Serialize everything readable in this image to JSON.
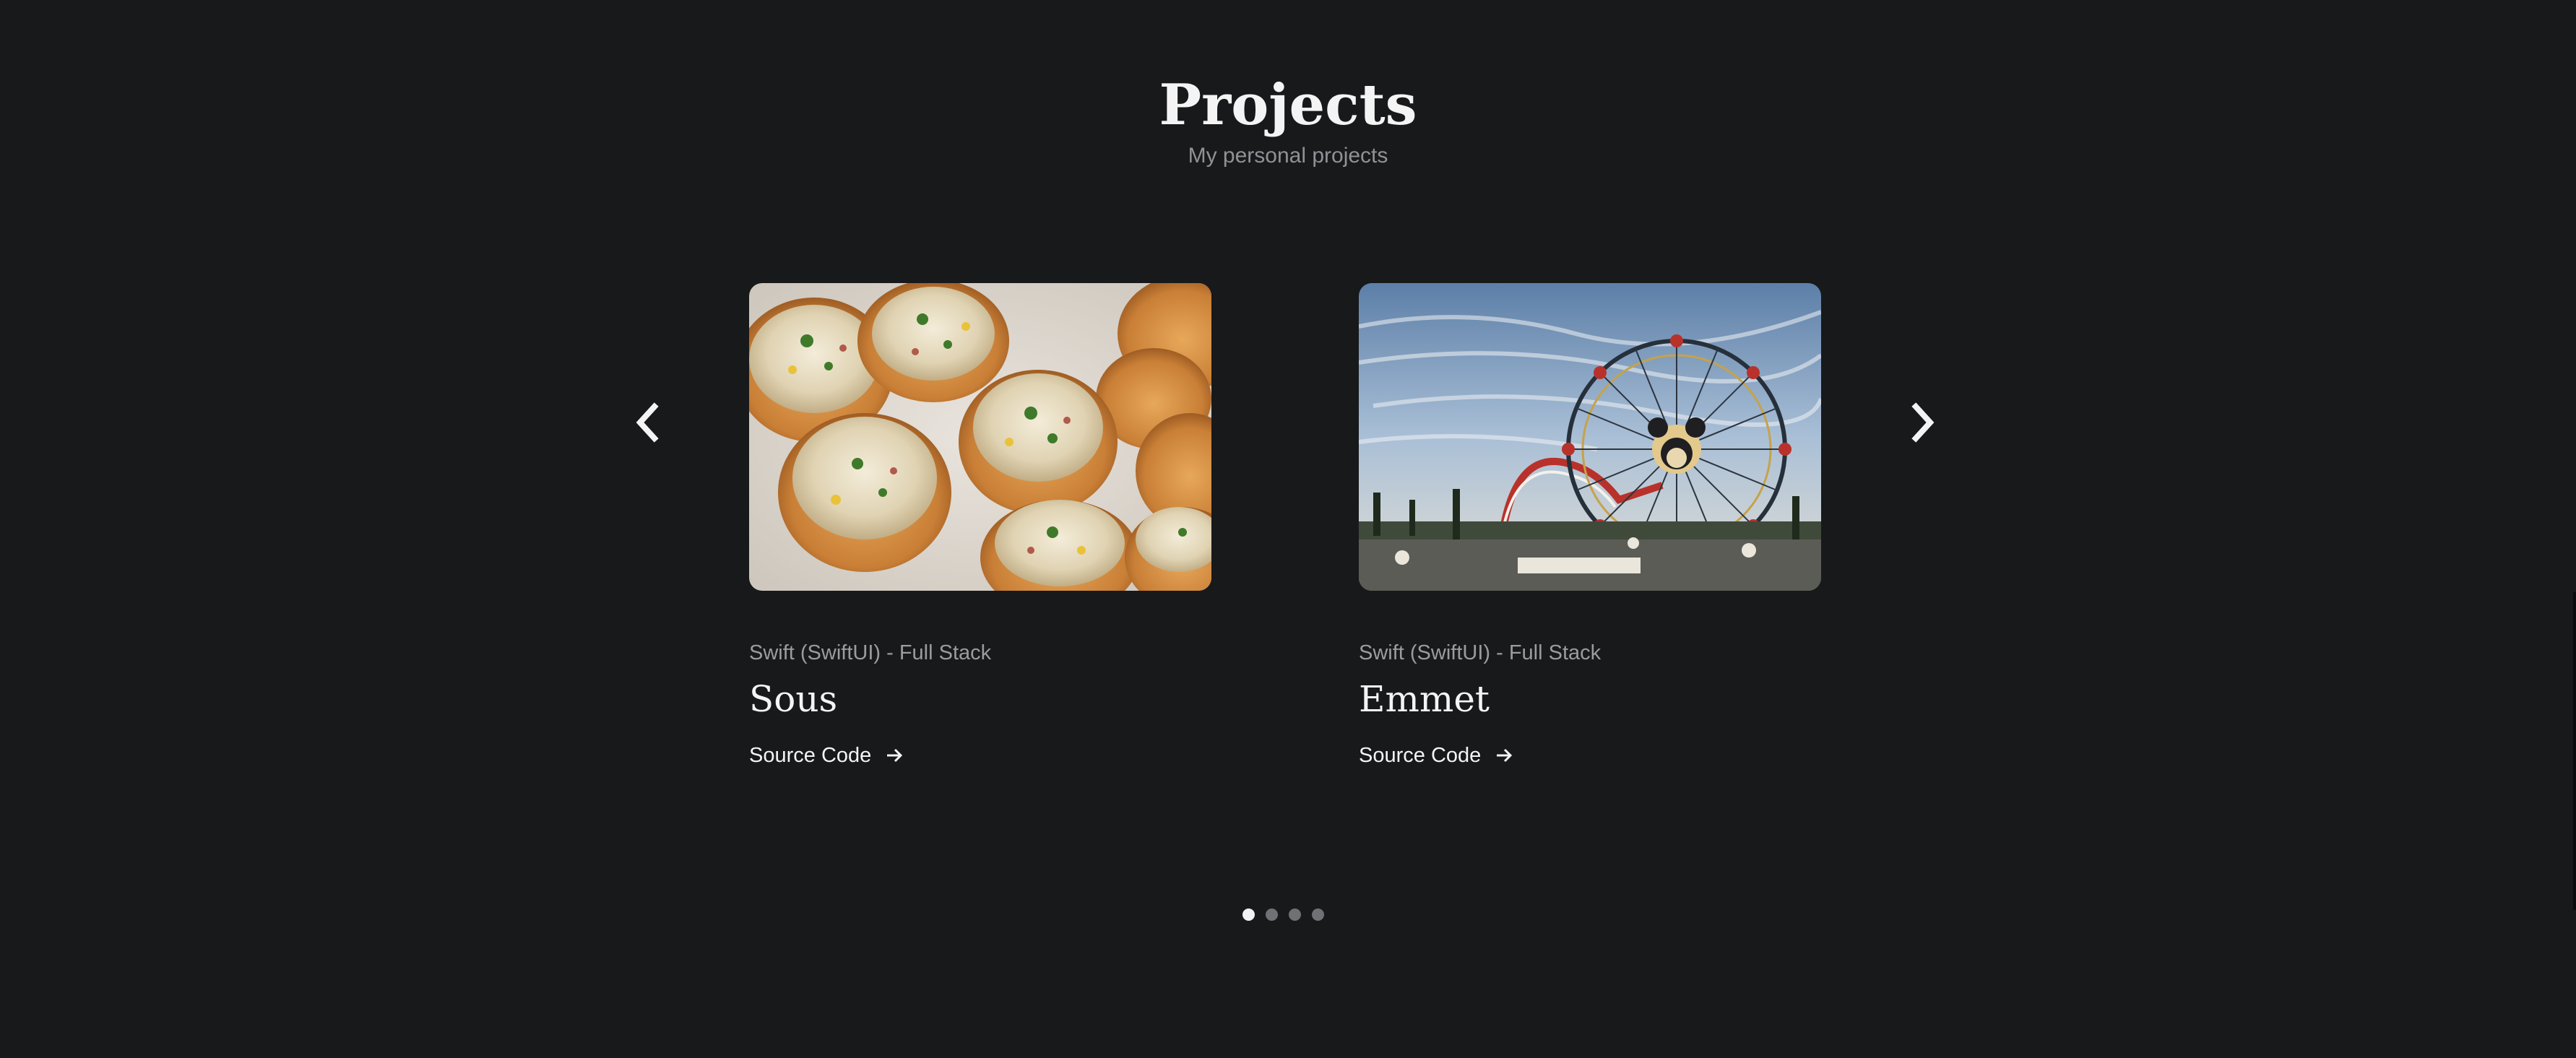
{
  "header": {
    "title": "Projects",
    "subtitle": "My personal projects"
  },
  "carousel": {
    "prev_icon": "chevron-left-icon",
    "next_icon": "chevron-right-icon",
    "cards": [
      {
        "category": "Swift (SwiftUI) - Full Stack",
        "name": "Sous",
        "link_label": "Source Code",
        "image_subject": "food-photo"
      },
      {
        "category": "Swift (SwiftUI) - Full Stack",
        "name": "Emmet",
        "link_label": "Source Code",
        "image_subject": "ferris-wheel-photo"
      }
    ],
    "pagination": {
      "total": 4,
      "active": 1
    }
  },
  "colors": {
    "background": "#18191b",
    "text_primary": "#f4f4f4",
    "text_secondary": "#8f9296",
    "dot_active": "#f2f2f2",
    "dot_inactive": "#6f7175"
  }
}
